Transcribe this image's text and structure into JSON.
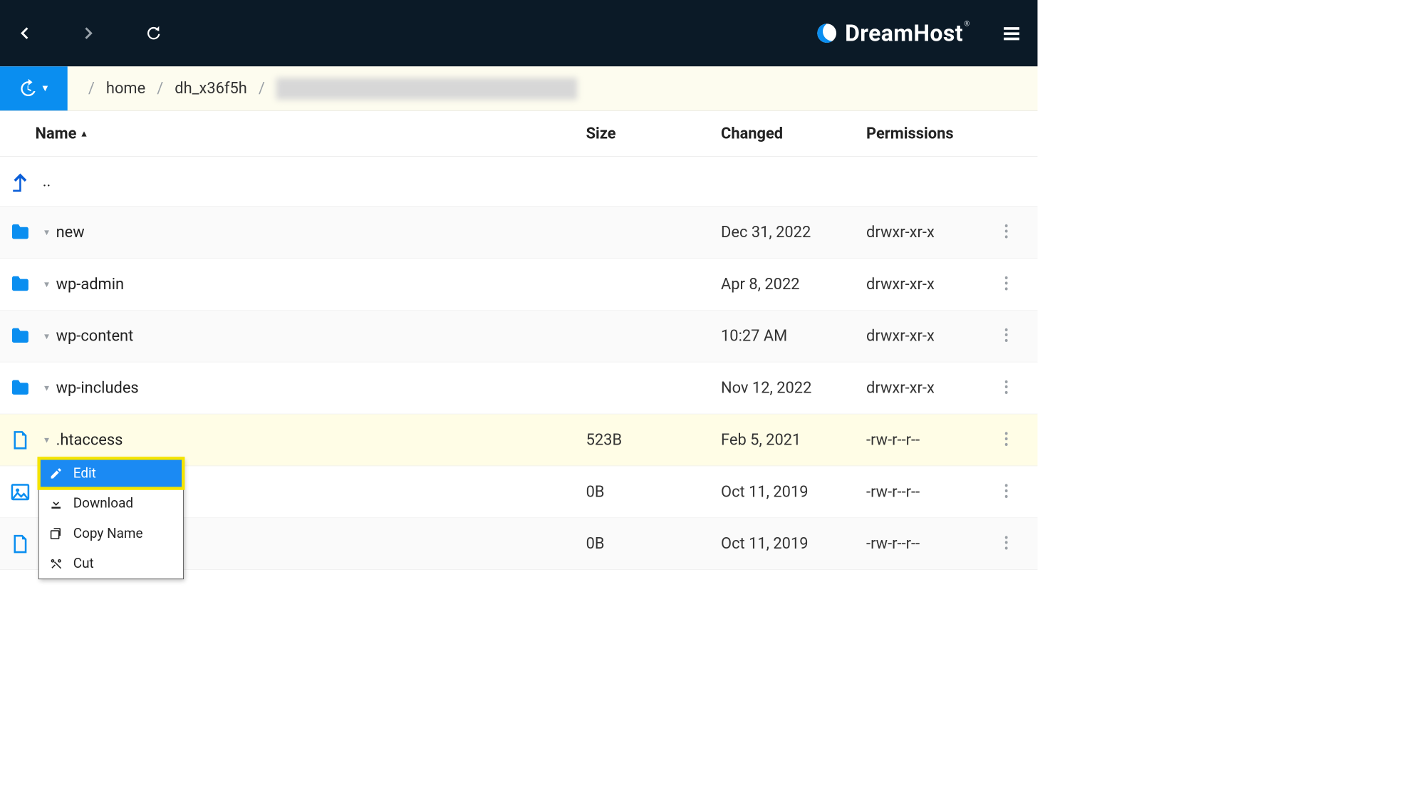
{
  "brand": "DreamHost",
  "breadcrumb": {
    "items": [
      "home",
      "dh_x36f5h"
    ],
    "redacted": true
  },
  "columns": {
    "name": "Name",
    "size": "Size",
    "changed": "Changed",
    "permissions": "Permissions"
  },
  "parent_label": "..",
  "rows": [
    {
      "type": "folder",
      "name": "new",
      "size": "",
      "changed": "Dec 31, 2022",
      "perm": "drwxr-xr-x",
      "stripe": true
    },
    {
      "type": "folder",
      "name": "wp-admin",
      "size": "",
      "changed": "Apr 8, 2022",
      "perm": "drwxr-xr-x",
      "stripe": false
    },
    {
      "type": "folder",
      "name": "wp-content",
      "size": "",
      "changed": "10:27 AM",
      "perm": "drwxr-xr-x",
      "stripe": true
    },
    {
      "type": "folder",
      "name": "wp-includes",
      "size": "",
      "changed": "Nov 12, 2022",
      "perm": "drwxr-xr-x",
      "stripe": false
    },
    {
      "type": "file",
      "name": ".htaccess",
      "size": "523B",
      "changed": "Feb 5, 2021",
      "perm": "-rw-r--r--",
      "highlight": true
    },
    {
      "type": "image",
      "name": "",
      "size": "0B",
      "changed": "Oct 11, 2019",
      "perm": "-rw-r--r--",
      "stripe": false
    },
    {
      "type": "file",
      "name": "",
      "size": "0B",
      "changed": "Oct 11, 2019",
      "perm": "-rw-r--r--",
      "stripe": true
    }
  ],
  "context_menu": {
    "items": [
      {
        "label": "Edit",
        "icon": "edit-icon",
        "active": true
      },
      {
        "label": "Download",
        "icon": "download-icon"
      },
      {
        "label": "Copy Name",
        "icon": "copy-icon"
      },
      {
        "label": "Cut",
        "icon": "cut-icon"
      }
    ]
  }
}
